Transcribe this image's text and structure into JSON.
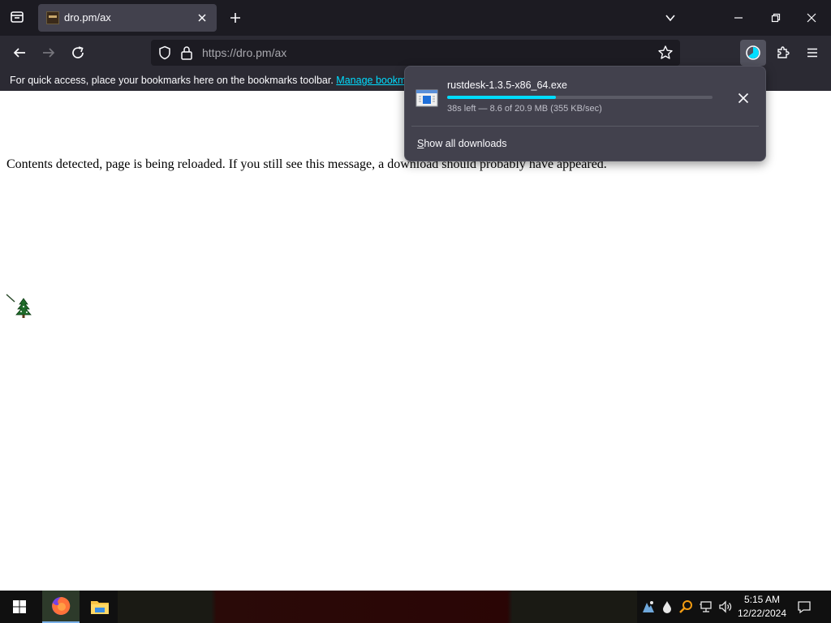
{
  "tab": {
    "title": "dro.pm/ax"
  },
  "urlbar": {
    "url": "https://dro.pm/ax"
  },
  "bookmarks_bar": {
    "message": "For quick access, place your bookmarks here on the bookmarks toolbar.",
    "link": "Manage bookmarks"
  },
  "page": {
    "message": "Contents detected, page is being reloaded. If you still see this message, a download should probably have appeared."
  },
  "download": {
    "filename": "rustdesk-1.3.5-x86_64.exe",
    "status": "38s left — 8.6 of 20.9 MB (355 KB/sec)",
    "progress_fraction": 0.41,
    "show_all": "Show all downloads"
  },
  "taskbar": {
    "time": "5:15 AM",
    "date": "12/22/2024"
  },
  "colors": {
    "accent": "#00ddff",
    "toolbar": "#2b2a33",
    "tabstrip": "#1c1b22"
  }
}
